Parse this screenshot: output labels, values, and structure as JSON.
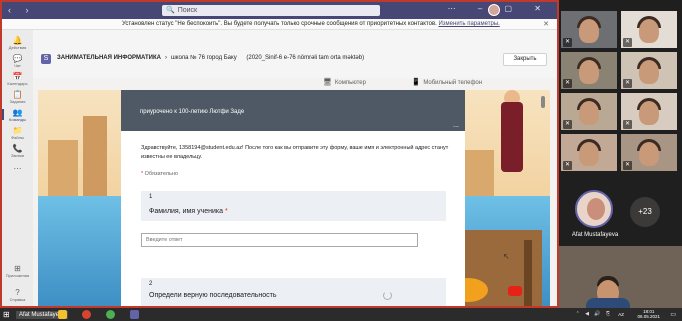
{
  "window": {
    "search_placeholder": "Поиск",
    "nav_arrows": "‹ ›",
    "window_controls": "⋯ – ▢ ✕"
  },
  "notice": {
    "text": "Установлен статус \"Не беспокоить\". Вы будете получать только срочные сообщения от приоритетных контактов.",
    "link": "Изменить параметры.",
    "close": "✕"
  },
  "rail": {
    "items": [
      {
        "icon": "🔔",
        "label": "Действия"
      },
      {
        "icon": "💬",
        "label": "Чат"
      },
      {
        "icon": "📅",
        "label": "Календарь"
      },
      {
        "icon": "📋",
        "label": "Задания"
      },
      {
        "icon": "👥",
        "label": "Команды"
      },
      {
        "icon": "📁",
        "label": "Файлы"
      },
      {
        "icon": "📞",
        "label": "Звонки"
      },
      {
        "icon": "⋯",
        "label": ""
      },
      {
        "icon": "⊞",
        "label": "Приложения"
      },
      {
        "icon": "?",
        "label": "Справка"
      }
    ],
    "active_index": 4
  },
  "tabhead": {
    "team_name": "ЗАНИМАТЕЛЬНАЯ ИНФОРМАТИКА",
    "school": "школа № 76 город Баку",
    "class": "(2020_Sinif-6 e-76 nömrəli tam orta məktəb)",
    "close_label": "Закрыть",
    "view_computer": "Компьютер",
    "view_mobile": "Мобильный телефон"
  },
  "form": {
    "top_partial": "",
    "subtitle": "приурочено к 100-летию Лютфи Заде",
    "dots": "...",
    "description": "Здравствуйте, 1358194@student.edu.az! После того как вы отправите эту форму, ваше имя и электронный адрес станут известны ее владельцу.",
    "required_mark": "*",
    "required_label": "Обязательно",
    "q1_number": "1",
    "q1_title": "Фамилия, имя ученика",
    "q1_star": "*",
    "q1_placeholder": "Введите ответ",
    "q2_number": "2",
    "q2_title": "Определи верную последовательность"
  },
  "video": {
    "tiles_count": 8,
    "big_name": "Afat Mustafayeva",
    "more_count": "+23"
  },
  "taskbar": {
    "active_name": "Afat Mustafayeva",
    "lang": "AZ",
    "time": "18:01",
    "date": "06.05.2021",
    "tray": "⌃ ◀ 🔊 ⎘",
    "notif": "▭"
  },
  "colors": {
    "teams_purple": "#464775",
    "accent": "#6264a7",
    "form_header": "#4f5965",
    "required_red": "#d93025"
  }
}
